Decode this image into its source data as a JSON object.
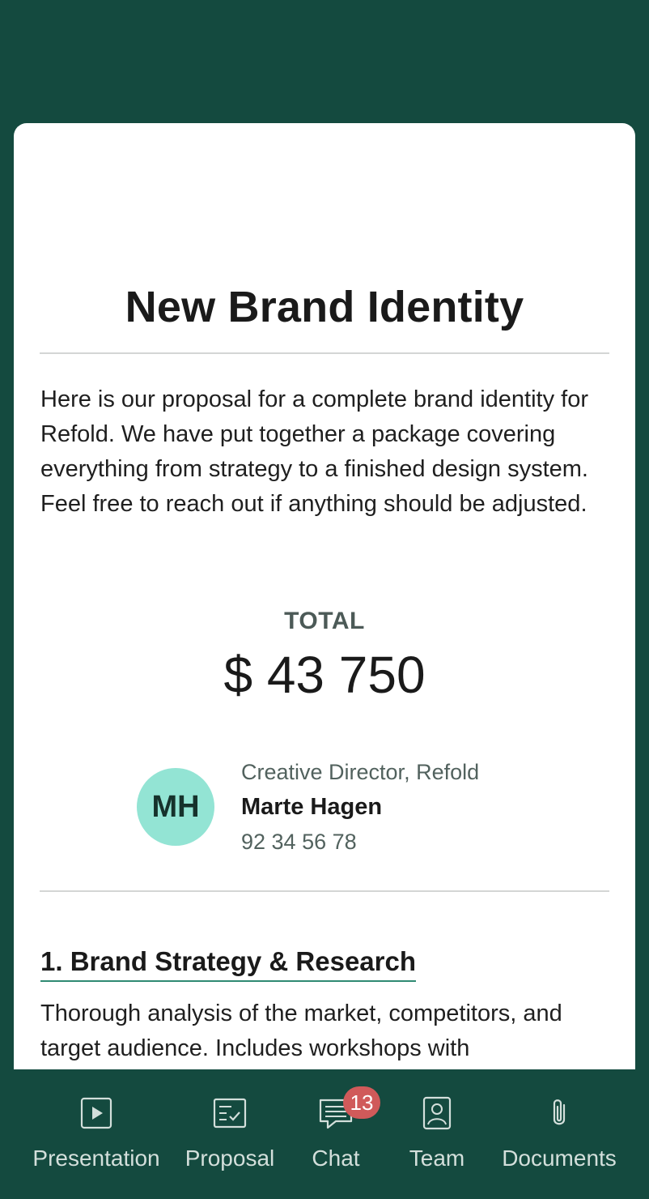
{
  "proposal": {
    "title": "New Brand Identity",
    "intro": "Here is our proposal for a complete brand identity for Refold. We have put together a package covering everything from strategy to a finished design system. Feel free to reach out if anything should be adjusted.",
    "total_label": "TOTAL",
    "total_value": "$ 43 750"
  },
  "contact": {
    "initials": "MH",
    "role": "Creative Director, Refold",
    "name": "Marte Hagen",
    "phone": "92 34 56 78"
  },
  "sections": [
    {
      "heading": "1. Brand Strategy & Research",
      "body": "Thorough analysis of the market, competitors, and target audience. Includes workshops with"
    }
  ],
  "tabbar": {
    "items": [
      {
        "label": "Presentation",
        "icon": "play-icon"
      },
      {
        "label": "Proposal",
        "icon": "checklist-icon"
      },
      {
        "label": "Chat",
        "icon": "chat-icon",
        "badge": "13"
      },
      {
        "label": "Team",
        "icon": "person-card-icon"
      },
      {
        "label": "Documents",
        "icon": "paperclip-icon"
      }
    ]
  },
  "colors": {
    "brand_green": "#144a3f",
    "avatar_bg": "#93e4d4",
    "badge": "#d05a5a",
    "heading_underline": "#2f8a73"
  }
}
